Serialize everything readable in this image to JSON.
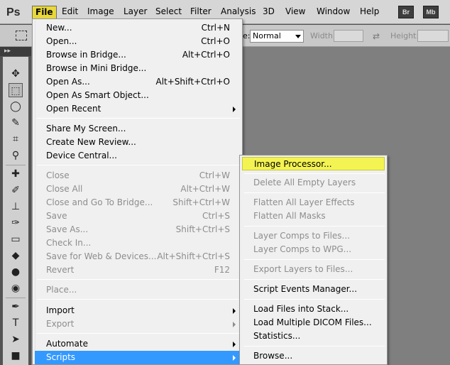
{
  "menubar": {
    "logo": "Ps",
    "items": [
      "File",
      "Edit",
      "Image",
      "Layer",
      "Select",
      "Filter",
      "Analysis",
      "3D",
      "View",
      "Window",
      "Help"
    ],
    "app_buttons": [
      "Br",
      "Mb"
    ]
  },
  "options": {
    "style_label": "e:",
    "style_value": "Normal",
    "width_label": "Width:",
    "height_label": "Height:"
  },
  "toolbox": {
    "header": "▸▸"
  },
  "file_menu": {
    "items": [
      {
        "label": "New...",
        "shortcut": "Ctrl+N"
      },
      {
        "label": "Open...",
        "shortcut": "Ctrl+O"
      },
      {
        "label": "Browse in Bridge...",
        "shortcut": "Alt+Ctrl+O"
      },
      {
        "label": "Browse in Mini Bridge...",
        "shortcut": ""
      },
      {
        "label": "Open As...",
        "shortcut": "Alt+Shift+Ctrl+O"
      },
      {
        "label": "Open As Smart Object...",
        "shortcut": ""
      },
      {
        "label": "Open Recent",
        "shortcut": ""
      },
      {
        "label": "Share My Screen...",
        "shortcut": ""
      },
      {
        "label": "Create New Review...",
        "shortcut": ""
      },
      {
        "label": "Device Central...",
        "shortcut": ""
      },
      {
        "label": "Close",
        "shortcut": "Ctrl+W"
      },
      {
        "label": "Close All",
        "shortcut": "Alt+Ctrl+W"
      },
      {
        "label": "Close and Go To Bridge...",
        "shortcut": "Shift+Ctrl+W"
      },
      {
        "label": "Save",
        "shortcut": "Ctrl+S"
      },
      {
        "label": "Save As...",
        "shortcut": "Shift+Ctrl+S"
      },
      {
        "label": "Check In...",
        "shortcut": ""
      },
      {
        "label": "Save for Web & Devices...",
        "shortcut": "Alt+Shift+Ctrl+S"
      },
      {
        "label": "Revert",
        "shortcut": "F12"
      },
      {
        "label": "Place...",
        "shortcut": ""
      },
      {
        "label": "Import",
        "shortcut": ""
      },
      {
        "label": "Export",
        "shortcut": ""
      },
      {
        "label": "Automate",
        "shortcut": ""
      },
      {
        "label": "Scripts",
        "shortcut": ""
      }
    ]
  },
  "scripts_menu": {
    "items": [
      {
        "label": "Image Processor..."
      },
      {
        "label": "Delete All Empty Layers"
      },
      {
        "label": "Flatten All Layer Effects"
      },
      {
        "label": "Flatten All Masks"
      },
      {
        "label": "Layer Comps to Files..."
      },
      {
        "label": "Layer Comps to WPG..."
      },
      {
        "label": "Export Layers to Files..."
      },
      {
        "label": "Script Events Manager..."
      },
      {
        "label": "Load Files into Stack..."
      },
      {
        "label": "Load Multiple DICOM Files..."
      },
      {
        "label": "Statistics..."
      },
      {
        "label": "Browse..."
      }
    ]
  },
  "colors": {
    "menu_highlight": "#3399ff",
    "hover_highlight": "#f3f353",
    "active_menu": "#e8d83a"
  }
}
